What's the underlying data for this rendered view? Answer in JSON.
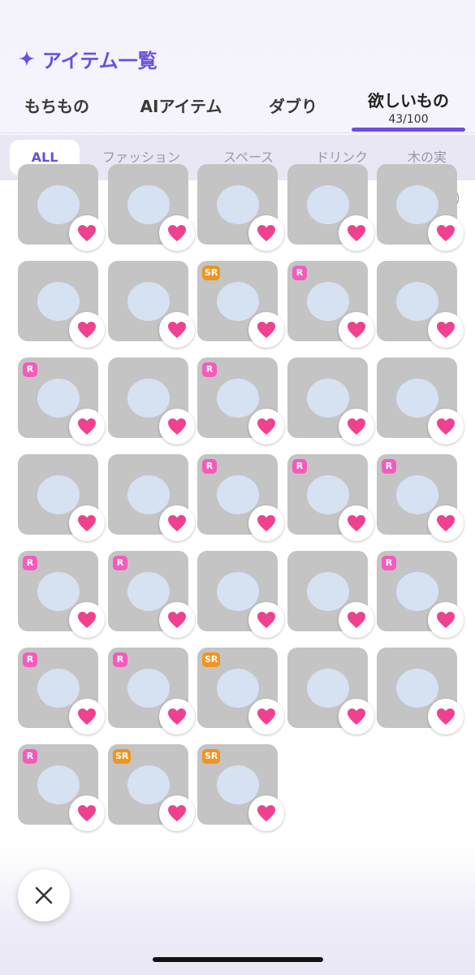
{
  "header": {
    "title": "アイテム一覧",
    "accent": "#6b4fe0"
  },
  "tabs": [
    {
      "label": "もちもの"
    },
    {
      "label": "AIアイテム"
    },
    {
      "label": "ダブり"
    },
    {
      "label": "欲しいもの",
      "count": "43/100",
      "active": true
    }
  ],
  "categories": [
    {
      "label": "ALL",
      "active": true
    },
    {
      "label": "ファッション"
    },
    {
      "label": "スペース"
    },
    {
      "label": "ドリンク"
    },
    {
      "label": "木の実"
    }
  ],
  "help_label": "?",
  "grid": {
    "columns": 5,
    "items": [
      {
        "badge": "",
        "thumb": "shoes-cherry-icon"
      },
      {
        "badge": "",
        "thumb": "heart-glasses-icon"
      },
      {
        "badge": "",
        "thumb": "shoes-red-icon"
      },
      {
        "badge": "",
        "thumb": "outfit-icon"
      },
      {
        "badge": "",
        "thumb": "outfit-icon"
      },
      {
        "badge": "",
        "thumb": "antenna-head-icon"
      },
      {
        "badge": "",
        "thumb": "head-icon"
      },
      {
        "badge": "SR",
        "thumb": "green-hair-icon"
      },
      {
        "badge": "R",
        "thumb": "purple-jacket-icon"
      },
      {
        "badge": "",
        "thumb": "head-icon"
      },
      {
        "badge": "R",
        "thumb": "yellow-hair-icon"
      },
      {
        "badge": "",
        "thumb": "halo-head-icon"
      },
      {
        "badge": "R",
        "thumb": "wing-body-icon"
      },
      {
        "badge": "",
        "thumb": "sailor-top-icon"
      },
      {
        "badge": "",
        "thumb": "shirt-tie-icon"
      },
      {
        "badge": "",
        "thumb": "white-shirt-icon"
      },
      {
        "badge": "",
        "thumb": "smile-head-icon"
      },
      {
        "badge": "R",
        "thumb": "platform-shoes-icon"
      },
      {
        "badge": "R",
        "thumb": "gray-jacket-icon"
      },
      {
        "badge": "R",
        "thumb": "denim-jacket-icon"
      },
      {
        "badge": "R",
        "thumb": "bucket-hat-icon"
      },
      {
        "badge": "R",
        "thumb": "brown-eyes-icon"
      },
      {
        "badge": "",
        "thumb": "black-pants-icon"
      },
      {
        "badge": "",
        "thumb": "black-jacket-icon"
      },
      {
        "badge": "R",
        "thumb": "black-cardigan-icon"
      },
      {
        "badge": "R",
        "thumb": "black-beret-icon"
      },
      {
        "badge": "R",
        "thumb": "pink-hair-icon"
      },
      {
        "badge": "SR",
        "thumb": "long-black-hair-icon"
      },
      {
        "badge": "",
        "thumb": "round-glasses-icon"
      },
      {
        "badge": "",
        "thumb": "flower-tattoo-icon"
      },
      {
        "badge": "R",
        "thumb": "bat-wings-icon"
      },
      {
        "badge": "SR",
        "thumb": "purple-eyes-icon"
      },
      {
        "badge": "SR",
        "thumb": "blue-hair-icon"
      }
    ]
  },
  "colors": {
    "heart": "#f0418f",
    "badge_r": "#f45bbd",
    "badge_sr": "#f0941e"
  }
}
